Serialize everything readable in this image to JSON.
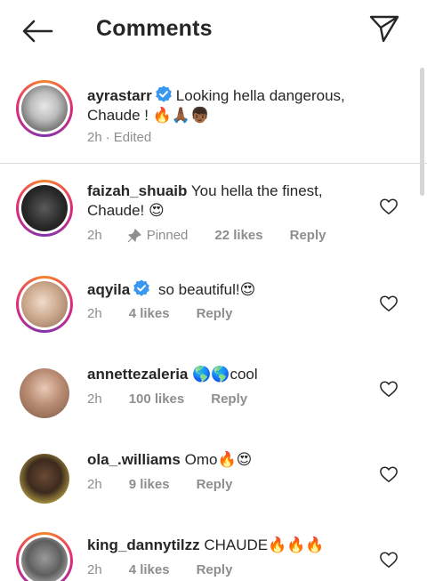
{
  "header": {
    "title": "Comments"
  },
  "caption": {
    "username": "ayrastarr",
    "text": "Looking hella dangerous, Chaude ! 🔥🙏🏾👦🏾",
    "time": "2h",
    "edited": "Edited"
  },
  "comments": [
    {
      "username": "faizah_shuaib",
      "text": "You hella the finest, Chaude! 😍",
      "time": "2h",
      "pinned": "Pinned",
      "likes": "22 likes",
      "reply": "Reply"
    },
    {
      "username": "aqyila",
      "text": "so beautiful!😍",
      "time": "2h",
      "likes": "4 likes",
      "reply": "Reply"
    },
    {
      "username": "annettezaleria",
      "text": "🌎🌎cool",
      "time": "2h",
      "likes": "100 likes",
      "reply": "Reply"
    },
    {
      "username": "ola_.williams",
      "text": "Omo🔥😍",
      "time": "2h",
      "likes": "9 likes",
      "reply": "Reply"
    },
    {
      "username": "king_dannytilzz",
      "text": "CHAUDE🔥🔥🔥",
      "time": "2h",
      "likes": "4 likes",
      "reply": "Reply"
    }
  ],
  "icons": {
    "back": "arrow-left-icon",
    "send": "paper-plane-icon",
    "verified": "verified-badge-icon",
    "pin": "pin-icon",
    "like": "heart-outline-icon"
  },
  "colors": {
    "verified": "#3897f0",
    "muted": "#8e8e8e",
    "text": "#262626"
  }
}
